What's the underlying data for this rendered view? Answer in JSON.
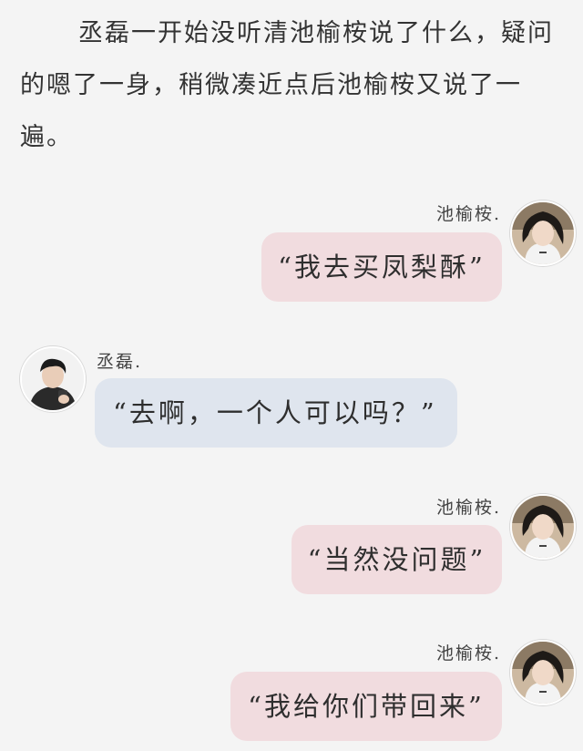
{
  "narration": "丞磊一开始没听清池榆桉说了什么，疑问的嗯了一身，稍微凑近点后池榆桉又说了一遍。",
  "messages": [
    {
      "sender": "池榆桉.",
      "side": "right",
      "text": "“我去买凤梨酥”"
    },
    {
      "sender": "丞磊.",
      "side": "left",
      "text": "“去啊，一个人可以吗？”"
    },
    {
      "sender": "池榆桉.",
      "side": "right",
      "text": "“当然没问题”"
    },
    {
      "sender": "池榆桉.",
      "side": "right",
      "text": "“我给你们带回来”"
    }
  ],
  "colors": {
    "background": "#f4f4f4",
    "right_bubble": "#f1dcdf",
    "left_bubble": "#dfe5ee"
  },
  "avatars": {
    "right": "girl-portrait-avatar",
    "left": "boy-portrait-avatar"
  }
}
